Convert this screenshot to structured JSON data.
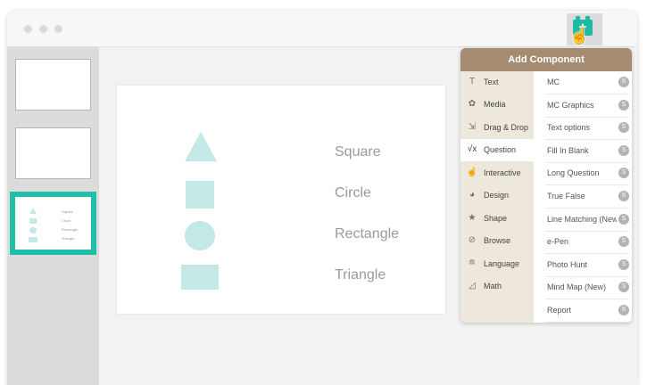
{
  "toolbar": {
    "add_component_icon": "add-component-icon",
    "add_component_symbol": "+",
    "cursor_symbol": "☝"
  },
  "slides": {
    "thumb3": {
      "labels": [
        "Square",
        "Circle",
        "Rectangle",
        "Triangle"
      ]
    }
  },
  "slide": {
    "labels": [
      "Square",
      "Circle",
      "Rectangle",
      "Triangle"
    ],
    "shape_color": "#c4e8e5"
  },
  "panel": {
    "title": "Add Component",
    "categories": [
      {
        "icon": "T",
        "label": "Text"
      },
      {
        "icon": "✿",
        "label": "Media"
      },
      {
        "icon": "⇲",
        "label": "Drag & Drop"
      },
      {
        "icon": "√x",
        "label": "Question"
      },
      {
        "icon": "☝",
        "label": "Interactive"
      },
      {
        "icon": "◕",
        "label": "Design"
      },
      {
        "icon": "★",
        "label": "Shape"
      },
      {
        "icon": "⊘",
        "label": "Browse"
      },
      {
        "icon": "≘",
        "label": "Language"
      },
      {
        "icon": "◿",
        "label": "Math"
      }
    ],
    "active_category": "Question",
    "items": [
      {
        "label": "MC",
        "badge": "S"
      },
      {
        "label": "MC Graphics",
        "badge": "S"
      },
      {
        "label": "Text options",
        "badge": "S"
      },
      {
        "label": "Fill In Blank",
        "badge": "S"
      },
      {
        "label": "Long Question",
        "badge": "S"
      },
      {
        "label": "True False",
        "badge": "S"
      },
      {
        "label": "Line Matching (New)",
        "badge": "S"
      },
      {
        "label": "e-Pen",
        "badge": "S"
      },
      {
        "label": "Photo Hunt",
        "badge": "S"
      },
      {
        "label": "Mind Map (New)",
        "badge": "S"
      },
      {
        "label": "Report",
        "badge": "S"
      }
    ]
  },
  "colors": {
    "accent": "#1fbfaa",
    "panel_header": "#a48b71",
    "panel_bg": "#ede7dc"
  }
}
